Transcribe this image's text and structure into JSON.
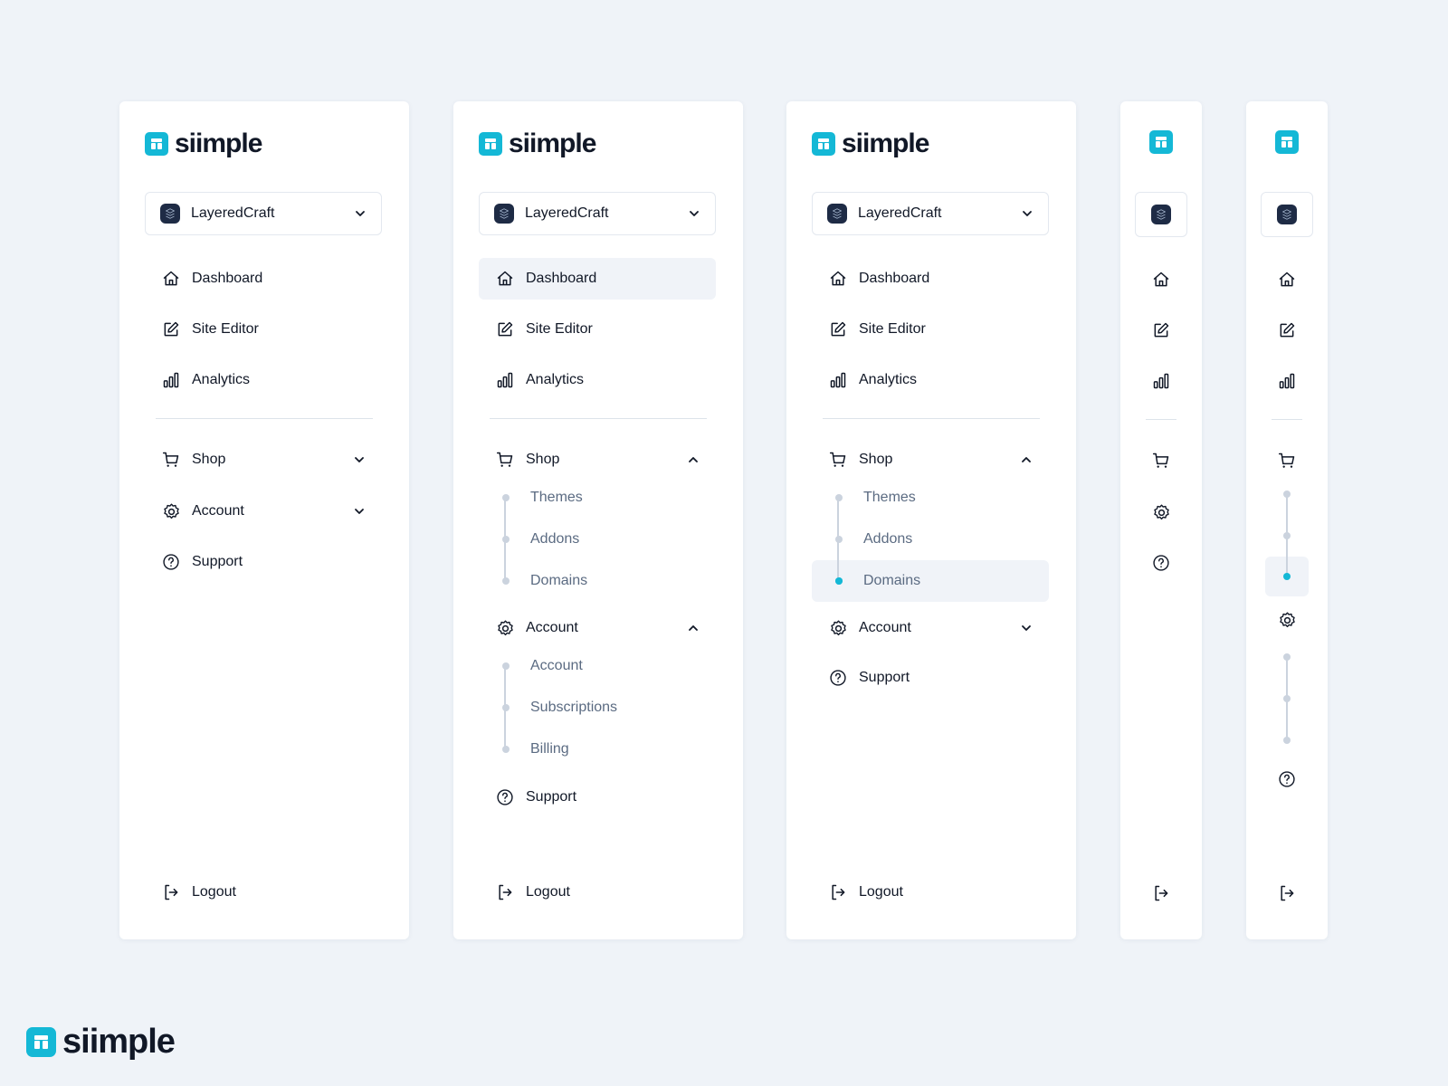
{
  "brand": {
    "name": "siimple",
    "accent": "#14b8d6"
  },
  "workspace": {
    "name": "LayeredCraft"
  },
  "nav": {
    "dashboard": "Dashboard",
    "site_editor": "Site Editor",
    "analytics": "Analytics",
    "shop": "Shop",
    "account": "Account",
    "support": "Support",
    "logout": "Logout"
  },
  "shop_sub": [
    "Themes",
    "Addons",
    "Domains"
  ],
  "account_sub": [
    "Account",
    "Subscriptions",
    "Billing"
  ],
  "variants": [
    {
      "state": "collapsed-groups",
      "active": null
    },
    {
      "state": "expanded-groups",
      "active": "Dashboard"
    },
    {
      "state": "shop-expanded",
      "active": "Domains"
    },
    {
      "state": "icon-only",
      "active": null
    },
    {
      "state": "icon-only-expanded",
      "active": "Domains"
    }
  ],
  "colors": {
    "background": "#eff3f8",
    "active_bg": "#f0f3f8",
    "sub_text": "#5b6b82",
    "dot": "#cbd3de",
    "workspace_avatar": "#1e2b45"
  }
}
